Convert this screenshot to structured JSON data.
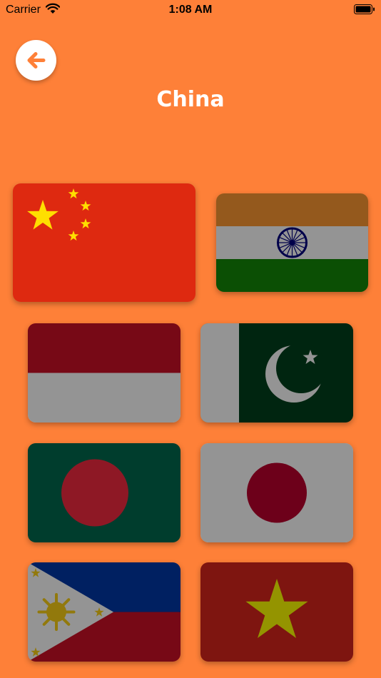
{
  "status_bar": {
    "carrier": "Carrier",
    "time": "1:08 AM",
    "wifi_icon": "wifi-icon",
    "battery_icon": "battery-icon"
  },
  "header": {
    "back_icon": "arrow-left-icon",
    "title": "China"
  },
  "colors": {
    "background": "#FE8038",
    "back_arrow": "#FE8038",
    "title_text": "#FFFFFF"
  },
  "flags": [
    {
      "country": "China",
      "selected": true
    },
    {
      "country": "India",
      "selected": false
    },
    {
      "country": "Indonesia",
      "selected": false
    },
    {
      "country": "Pakistan",
      "selected": false
    },
    {
      "country": "Bangladesh",
      "selected": false
    },
    {
      "country": "Japan",
      "selected": false
    },
    {
      "country": "Philippines",
      "selected": false
    },
    {
      "country": "Vietnam",
      "selected": false
    }
  ]
}
